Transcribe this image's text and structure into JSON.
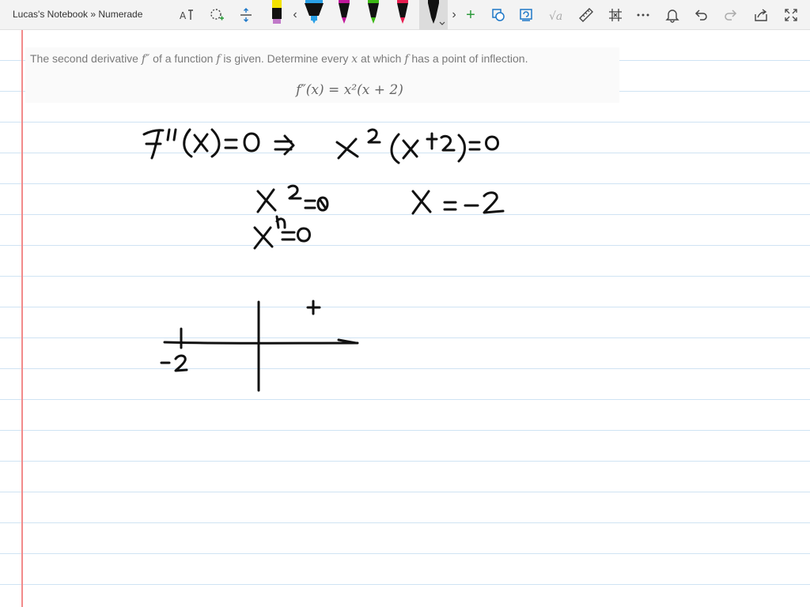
{
  "window": {
    "title": "Lucas's Notebook » Numerade"
  },
  "toolbar": {
    "icons": [
      "ink-to-text-icon",
      "lasso-select-icon",
      "insert-space-icon",
      "ruler-icon",
      "add-pen-icon",
      "shapes-icon",
      "ink-replay-icon",
      "ink-to-math-icon",
      "measure-icon",
      "grid-icon",
      "more-icon",
      "bell-icon",
      "undo-icon",
      "redo-icon",
      "share-icon",
      "fullscreen-icon"
    ],
    "pens": [
      {
        "name": "highlighter-yellow",
        "color": "#f2e200"
      },
      {
        "name": "pen-blue",
        "color": "#2aa0e6"
      },
      {
        "name": "pen-magenta",
        "color": "#c0189a"
      },
      {
        "name": "pen-green",
        "color": "#3cb815"
      },
      {
        "name": "pen-red",
        "color": "#e81e50"
      },
      {
        "name": "pen-black",
        "color": "#111111",
        "selected": true
      }
    ],
    "prev_arrow": "‹",
    "next_arrow": "›",
    "add_symbol": "+"
  },
  "problem": {
    "text_1": "The second derivative ",
    "fpp": "f″",
    "text_2": " of a function ",
    "f": "f",
    "text_3": " is given. Determine every ",
    "x": "x",
    "text_4": " at which ",
    "f2": "f",
    "text_5": " has a point of inflection.",
    "formula": "f″(x) = x²(x + 2)"
  },
  "colors": {
    "rule_lines": "#cfe3f3",
    "margin_line": "#f28b8b",
    "ink": "#111111"
  }
}
